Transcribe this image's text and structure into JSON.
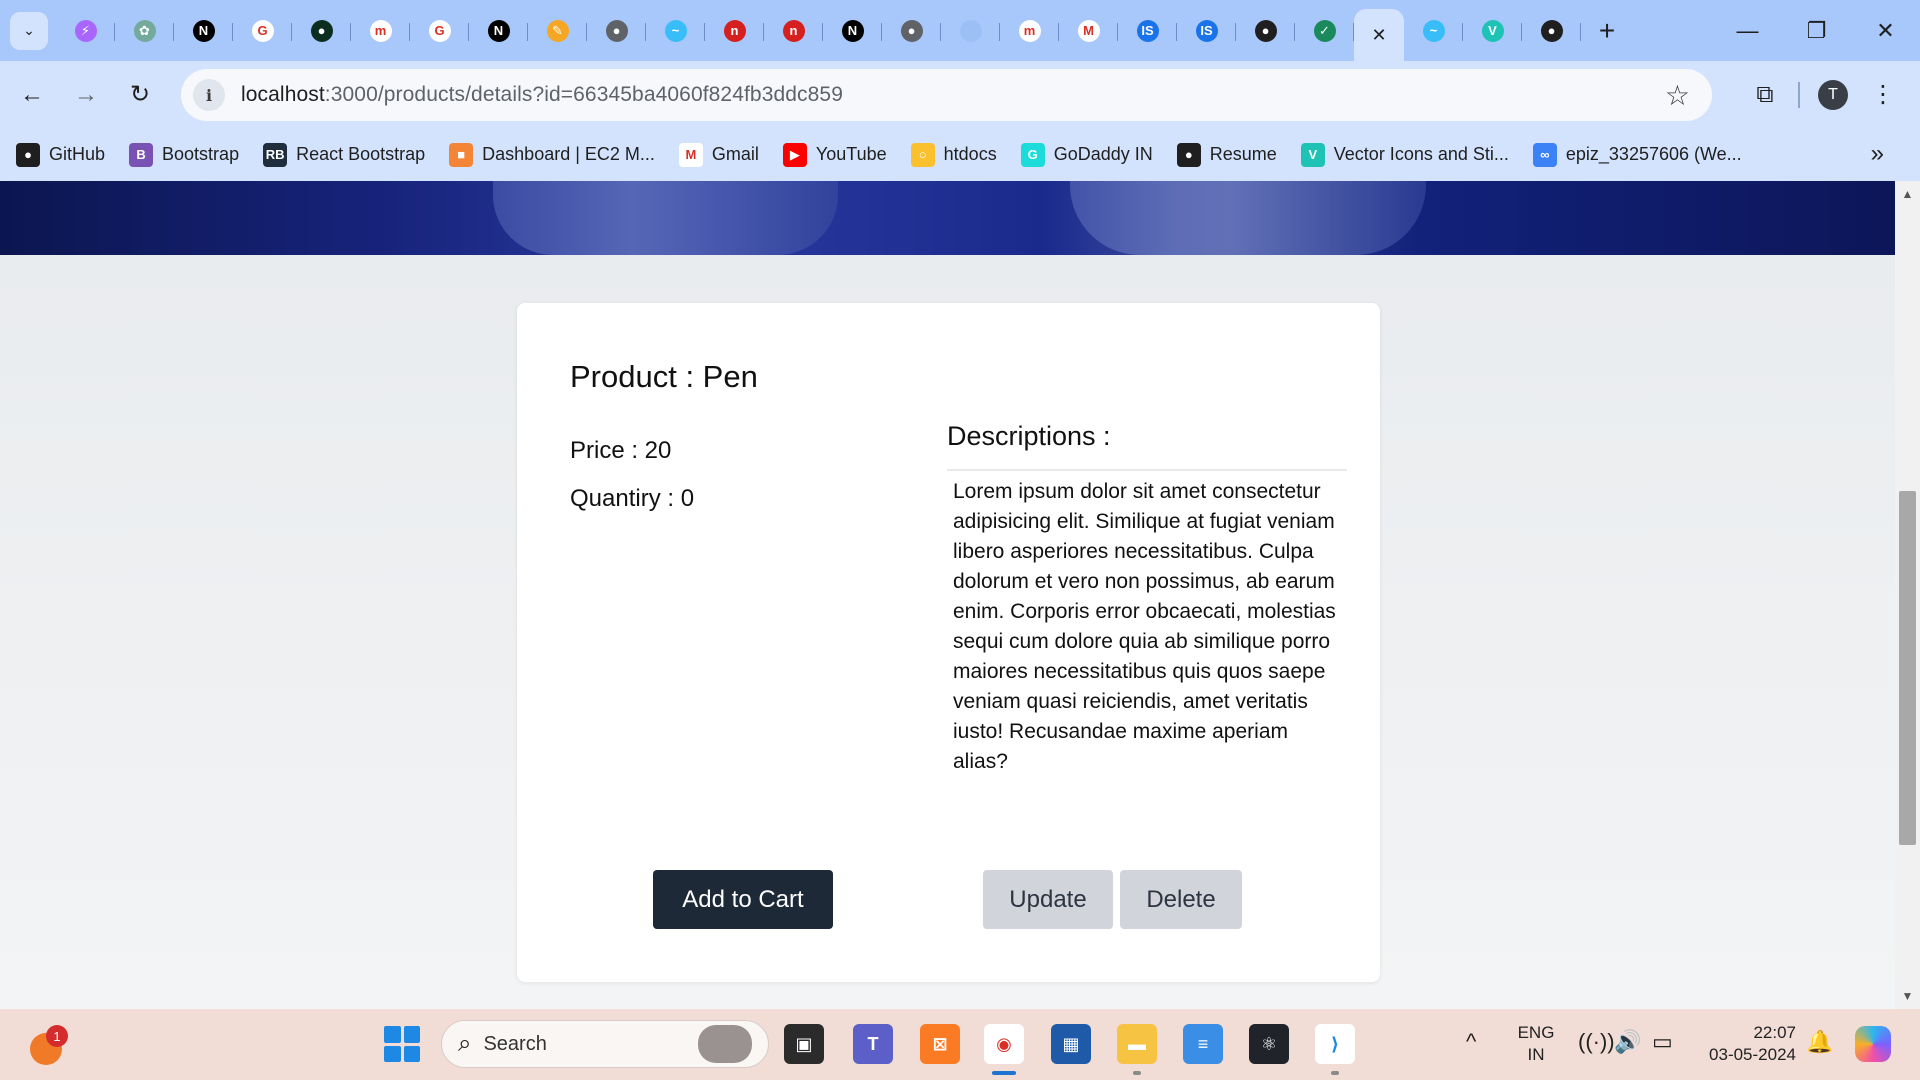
{
  "browser": {
    "tabs": [
      {
        "icon": "vite-icon",
        "color": "#a866ff",
        "glyph": "⚡"
      },
      {
        "icon": "chatgpt-icon",
        "color": "#74aa9c",
        "glyph": "✿"
      },
      {
        "icon": "nextjs-icon",
        "color": "#000000",
        "glyph": "N"
      },
      {
        "icon": "google-icon",
        "color": "#ffffff",
        "glyph": "G"
      },
      {
        "icon": "mongodb-icon",
        "color": "#0b2e1f",
        "glyph": "●"
      },
      {
        "icon": "medium-icon",
        "color": "#ffffff",
        "glyph": "m"
      },
      {
        "icon": "google-icon",
        "color": "#ffffff",
        "glyph": "G"
      },
      {
        "icon": "nextjs-icon",
        "color": "#000000",
        "glyph": "N"
      },
      {
        "icon": "pencil-icon",
        "color": "#f5a623",
        "glyph": "✎"
      },
      {
        "icon": "globe-icon",
        "color": "#5f6368",
        "glyph": "●"
      },
      {
        "icon": "tailwind-icon",
        "color": "#38bdf8",
        "glyph": "~"
      },
      {
        "icon": "netlify-icon",
        "color": "#d62020",
        "glyph": "n"
      },
      {
        "icon": "netlify-icon",
        "color": "#d62020",
        "glyph": "n"
      },
      {
        "icon": "nextjs-icon",
        "color": "#000000",
        "glyph": "N"
      },
      {
        "icon": "globe-icon",
        "color": "#5f6368",
        "glyph": "●"
      },
      {
        "icon": "blank-icon",
        "color": "#9cc0f5",
        "glyph": ""
      },
      {
        "icon": "medium-icon",
        "color": "#ffffff",
        "glyph": "m"
      },
      {
        "icon": "gmail-icon",
        "color": "#ffffff",
        "glyph": "M"
      },
      {
        "icon": "is-icon",
        "color": "#1a73e8",
        "glyph": "IS"
      },
      {
        "icon": "is-icon",
        "color": "#1a73e8",
        "glyph": "IS"
      },
      {
        "icon": "github-icon",
        "color": "#1f1f1f",
        "glyph": "●"
      },
      {
        "icon": "feather-icon",
        "color": "#1a8a5c",
        "glyph": "✓"
      }
    ],
    "active_tab": {
      "icon": "close-icon",
      "glyph": "✕"
    },
    "tabs_after": [
      {
        "icon": "tailwind-icon",
        "color": "#38bdf8",
        "glyph": "~"
      },
      {
        "icon": "vuetify-icon",
        "color": "#1fc3b5",
        "glyph": "V"
      },
      {
        "icon": "github-icon",
        "color": "#1f1f1f",
        "glyph": "●"
      }
    ],
    "new_tab_glyph": "+",
    "window_controls": {
      "minimize": "—",
      "restore": "❐",
      "close": "✕"
    },
    "nav": {
      "back": "←",
      "forward": "→",
      "reload": "↻"
    },
    "url_host": "localhost",
    "url_path": ":3000/products/details?id=66345ba4060f824fb3ddc859",
    "bookmark_star": "☆",
    "avatar_letter": "T",
    "menu_glyph": "⋮",
    "bookmarks": [
      {
        "label": "GitHub",
        "color": "#1f1f1f",
        "glyph": "●"
      },
      {
        "label": "Bootstrap",
        "color": "#7952b3",
        "glyph": "B"
      },
      {
        "label": "React Bootstrap",
        "color": "#1f2d3d",
        "glyph": "RB"
      },
      {
        "label": "Dashboard | EC2 M...",
        "color": "#f58536",
        "glyph": "■"
      },
      {
        "label": "Gmail",
        "color": "#ffffff",
        "glyph": "M"
      },
      {
        "label": "YouTube",
        "color": "#ff0000",
        "glyph": "▶"
      },
      {
        "label": "htdocs",
        "color": "#fbc02d",
        "glyph": "○"
      },
      {
        "label": "GoDaddy IN",
        "color": "#1bdbdb",
        "glyph": "G"
      },
      {
        "label": "Resume",
        "color": "#1f1f1f",
        "glyph": "●"
      },
      {
        "label": "Vector Icons and Sti...",
        "color": "#1fc3b5",
        "glyph": "V"
      },
      {
        "label": "epiz_33257606 (We...",
        "color": "#3b82f6",
        "glyph": "∞"
      }
    ],
    "bookmarks_more": "»"
  },
  "product": {
    "title": "Product : Pen",
    "price": "Price : 20",
    "quantity": "Quantiry : 0",
    "descriptions_heading": "Descriptions :",
    "description": "Lorem ipsum dolor sit amet consectetur adipisicing elit. Similique at fugiat veniam libero asperiores necessitatibus. Culpa dolorum et vero non possimus, ab earum enim. Corporis error obcaecati, molestias sequi cum dolore quia ab similique porro maiores necessitatibus quis quos saepe veniam quasi reiciendis, amet veritatis iusto! Recusandae maxime aperiam alias?",
    "add_to_cart_label": "Add to Cart",
    "update_label": "Update",
    "delete_label": "Delete"
  },
  "colors": {
    "primary_button": "#1e2937",
    "secondary_button": "#d1d5db",
    "chrome_tabstrip": "#a8c7fa",
    "chrome_toolbar": "#d3e3fd"
  },
  "taskbar": {
    "weather_badge": "1",
    "search_placeholder": "Search",
    "apps": [
      {
        "name": "task-view",
        "color": "#2b2b2b",
        "glyph": "▣"
      },
      {
        "name": "teams",
        "color": "#5b5fc7",
        "glyph": "T"
      },
      {
        "name": "xampp",
        "color": "#fb7a24",
        "glyph": "⊠"
      },
      {
        "name": "chrome",
        "color": "#ffffff",
        "glyph": "◉"
      },
      {
        "name": "microsoft-store",
        "color": "#1e5aa8",
        "glyph": "▦"
      },
      {
        "name": "file-explorer",
        "color": "#f6c342",
        "glyph": "▬"
      },
      {
        "name": "notepad",
        "color": "#3a8ee6",
        "glyph": "≡"
      },
      {
        "name": "react-devtools",
        "color": "#20232a",
        "glyph": "⚛"
      },
      {
        "name": "vscode",
        "color": "#ffffff",
        "glyph": "⟩"
      }
    ],
    "tray_chevron": "^",
    "lang_line1": "ENG",
    "lang_line2": "IN",
    "wifi": "((·))",
    "volume": "🔊",
    "battery": "▭",
    "time": "22:07",
    "date": "03-05-2024",
    "bell": "🔔"
  }
}
